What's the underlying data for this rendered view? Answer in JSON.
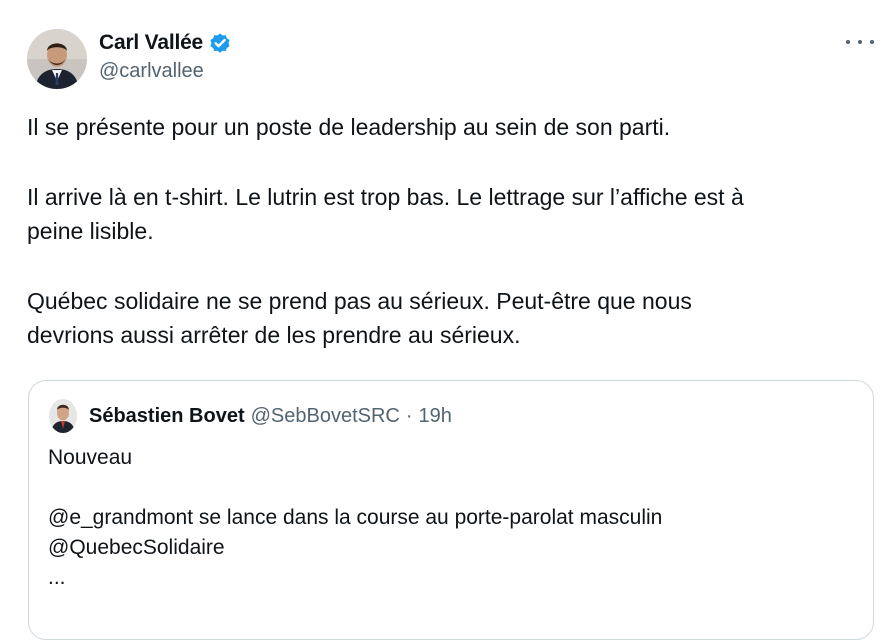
{
  "tweet": {
    "author_name": "Carl Vallée",
    "author_handle": "@carlvallee",
    "lines": [
      "Il se présente pour un poste de leadership au sein de son parti.",
      "Il arrive là en t-shirt. Le lutrin est trop bas. Le lettrage sur l’affiche est à",
      "peine lisible.",
      "Québec solidaire ne se prend pas au sérieux. Peut-être que nous",
      "devrions aussi arrêter de les prendre au sérieux."
    ]
  },
  "quoted": {
    "author_name": "Sébastien Bovet",
    "author_handle": "@SebBovetSRC",
    "separator": "·",
    "time": "19h",
    "lines": [
      "Nouveau",
      "@e_grandmont se lance dans la course au porte-parolat masculin",
      "@QuebecSolidaire",
      "..."
    ]
  },
  "icons": {
    "verified": "verified-badge-icon",
    "more": "more-options-icon"
  },
  "colors": {
    "text": "#0f1419",
    "secondary": "#536471",
    "verified": "#1d9bf0",
    "border": "#cfd9de"
  }
}
